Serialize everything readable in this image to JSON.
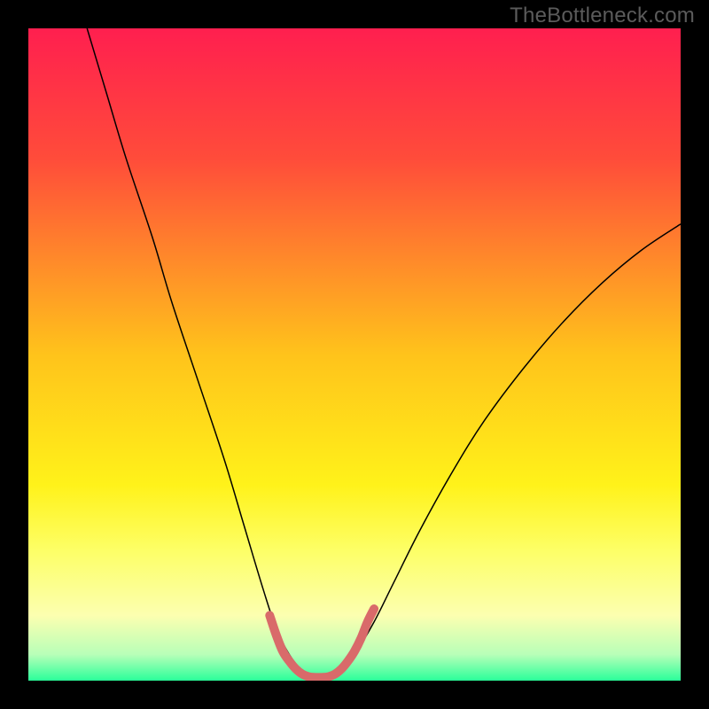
{
  "watermark": "TheBottleneck.com",
  "chart_data": {
    "type": "line",
    "title": "",
    "xlabel": "",
    "ylabel": "",
    "xlim": [
      0,
      100
    ],
    "ylim": [
      0,
      100
    ],
    "grid": false,
    "legend": "none",
    "background": {
      "type": "vertical-gradient",
      "stops": [
        {
          "pos": 0.0,
          "color": "#ff1f4f"
        },
        {
          "pos": 0.2,
          "color": "#ff4c3a"
        },
        {
          "pos": 0.5,
          "color": "#ffc31b"
        },
        {
          "pos": 0.7,
          "color": "#fff21a"
        },
        {
          "pos": 0.8,
          "color": "#fdff66"
        },
        {
          "pos": 0.9,
          "color": "#fcffb0"
        },
        {
          "pos": 0.96,
          "color": "#b8ffb8"
        },
        {
          "pos": 1.0,
          "color": "#2aff9a"
        }
      ]
    },
    "series": [
      {
        "name": "curve",
        "color": "#000000",
        "width": 1.5,
        "points": [
          {
            "x": 9,
            "y": 100
          },
          {
            "x": 12,
            "y": 90
          },
          {
            "x": 15,
            "y": 80
          },
          {
            "x": 19,
            "y": 68
          },
          {
            "x": 22,
            "y": 58
          },
          {
            "x": 26,
            "y": 46
          },
          {
            "x": 30,
            "y": 34
          },
          {
            "x": 33,
            "y": 24
          },
          {
            "x": 36,
            "y": 14
          },
          {
            "x": 38,
            "y": 8
          },
          {
            "x": 40,
            "y": 4
          },
          {
            "x": 42,
            "y": 1.5
          },
          {
            "x": 44,
            "y": 0.5
          },
          {
            "x": 46,
            "y": 0.5
          },
          {
            "x": 48,
            "y": 1.5
          },
          {
            "x": 50,
            "y": 4
          },
          {
            "x": 53,
            "y": 9
          },
          {
            "x": 56,
            "y": 15
          },
          {
            "x": 60,
            "y": 23
          },
          {
            "x": 65,
            "y": 32
          },
          {
            "x": 70,
            "y": 40
          },
          {
            "x": 76,
            "y": 48
          },
          {
            "x": 82,
            "y": 55
          },
          {
            "x": 88,
            "y": 61
          },
          {
            "x": 94,
            "y": 66
          },
          {
            "x": 100,
            "y": 70
          }
        ]
      },
      {
        "name": "marker",
        "color": "#d96a6a",
        "width": 10,
        "points": [
          {
            "x": 37,
            "y": 10
          },
          {
            "x": 38,
            "y": 7
          },
          {
            "x": 39,
            "y": 4.5
          },
          {
            "x": 40,
            "y": 3
          },
          {
            "x": 41,
            "y": 1.8
          },
          {
            "x": 42,
            "y": 1.0
          },
          {
            "x": 43,
            "y": 0.6
          },
          {
            "x": 44,
            "y": 0.5
          },
          {
            "x": 45,
            "y": 0.5
          },
          {
            "x": 46,
            "y": 0.6
          },
          {
            "x": 47,
            "y": 1.0
          },
          {
            "x": 48,
            "y": 1.8
          },
          {
            "x": 49,
            "y": 3
          },
          {
            "x": 50,
            "y": 4.5
          },
          {
            "x": 51,
            "y": 6.5
          },
          {
            "x": 52,
            "y": 9
          },
          {
            "x": 53,
            "y": 11
          }
        ]
      }
    ]
  }
}
